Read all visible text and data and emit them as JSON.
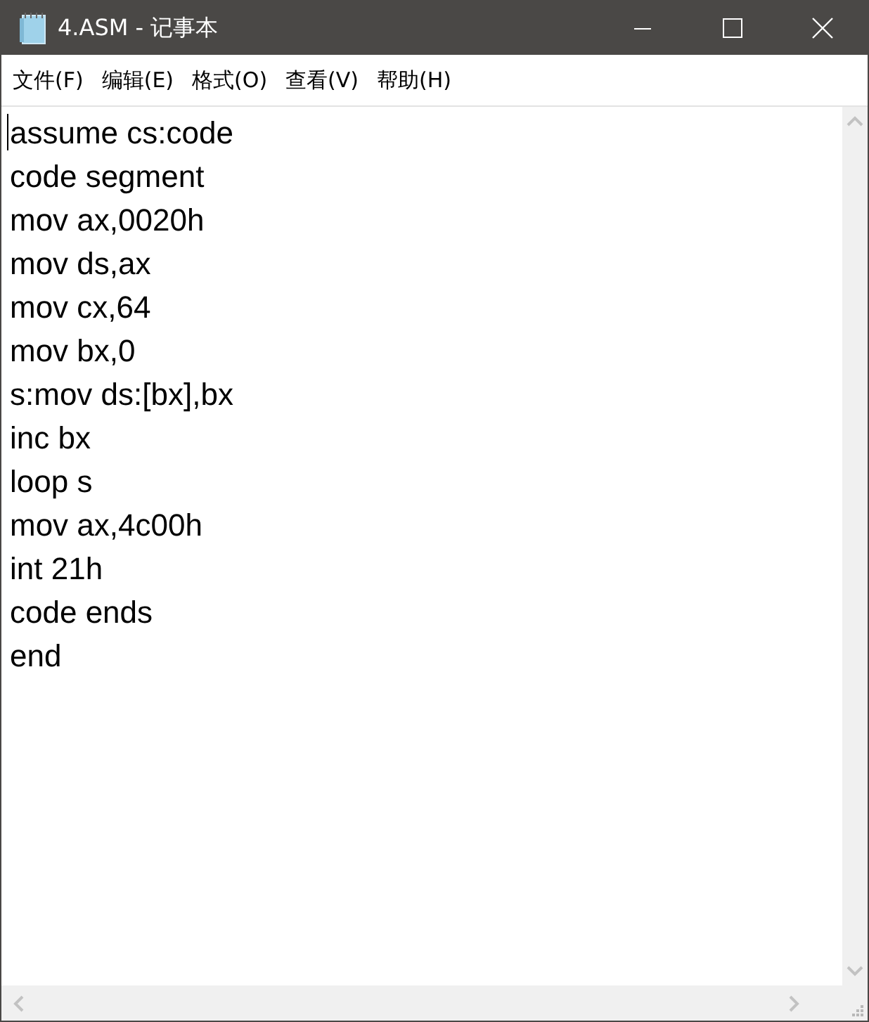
{
  "window": {
    "title": "4.ASM - 记事本"
  },
  "menu": [
    {
      "label": "文件(F)"
    },
    {
      "label": "编辑(E)"
    },
    {
      "label": "格式(O)"
    },
    {
      "label": "查看(V)"
    },
    {
      "label": "帮助(H)"
    }
  ],
  "editor": {
    "lines": [
      "assume cs:code",
      "code segment",
      "mov ax,0020h",
      "mov ds,ax",
      "mov cx,64",
      "mov bx,0",
      "s:mov ds:[bx],bx",
      "inc bx",
      "loop s",
      "mov ax,4c00h",
      "int 21h",
      "code ends",
      "end"
    ]
  }
}
